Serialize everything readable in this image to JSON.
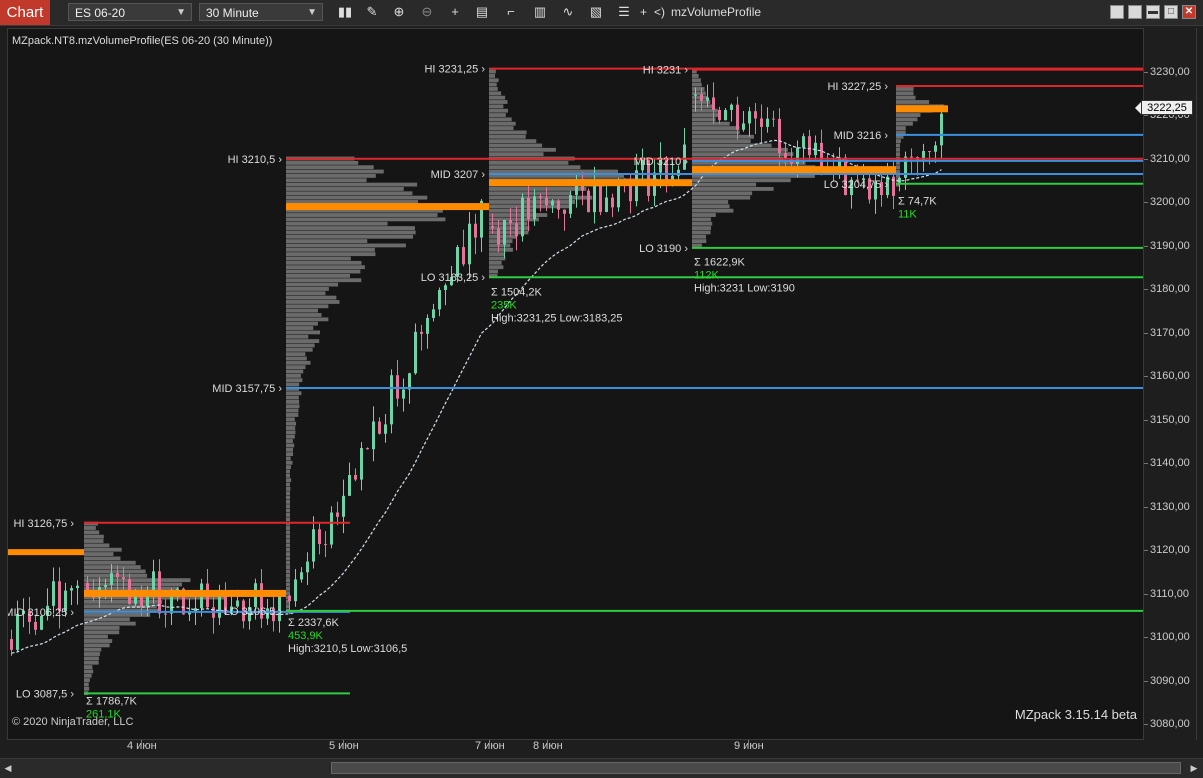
{
  "toolbar": {
    "chart_tab": "Chart",
    "instrument": "ES 06-20",
    "interval": "30 Minute",
    "indicator_name": "mzVolumeProfile",
    "plus_label": "+",
    "prev_label": "<)",
    "icons": [
      "bar-type-icon",
      "draw-pencil-icon",
      "zoom-in-icon",
      "zoom-out-icon",
      "crosshair-icon",
      "data-box-icon",
      "templates-icon",
      "strategies-icon",
      "indicators-icon",
      "properties-icon",
      "menu-icon"
    ]
  },
  "chart": {
    "title": "MZpack.NT8.mzVolumeProfile(ES 06-20 (30 Minute))",
    "copyright": "© 2020 NinjaTrader, LLC",
    "watermark": "MZpack 3.15.14 beta",
    "current_price": "3222,25",
    "colors": {
      "hi_line": "#e0262a",
      "lo_line": "#2ecc40",
      "mid_line": "#3b8fe0",
      "poc": "#ff8c00",
      "profile": "#7a7a7a",
      "va": "#9a9a9a",
      "green_text": "#22dd22",
      "up_candle": "#6fd3a8",
      "down_candle": "#e57399",
      "vwap": "#cfe0ea"
    }
  },
  "chart_data": {
    "type": "candlestick_volume_profile",
    "y_ticks": [
      "3230,00",
      "3220,00",
      "3210,00",
      "3200,00",
      "3190,00",
      "3180,00",
      "3170,00",
      "3160,00",
      "3150,00",
      "3140,00",
      "3130,00",
      "3120,00",
      "3110,00",
      "3100,00",
      "3090,00",
      "3080,00"
    ],
    "y_range": [
      3080,
      3234
    ],
    "x_ticks": [
      "4 июн",
      "5 июн",
      "7 июн",
      "8 июн",
      "9 июн"
    ],
    "profiles": [
      {
        "hi": "HI 3126,75",
        "mid": "MID 3106,25",
        "lo": "LO 3087,5",
        "poc": 3110.5,
        "sum": "Σ 1786,7K",
        "delta": "261,1K",
        "hi_v": 3126.75,
        "mid_v": 3106.25,
        "lo_v": 3087.5
      },
      {
        "hi": "HI 3210,5",
        "mid": "MID 3157,75",
        "lo": "LO 3106,5",
        "poc": 3199.5,
        "sum": "Σ 2337,6K",
        "delta": "453,9K",
        "range": "High:3210,5 Low:3106,5",
        "hi_v": 3210.5,
        "mid_v": 3157.75,
        "lo_v": 3106.5
      },
      {
        "hi": "HI 3231,25",
        "mid": "MID 3207",
        "lo": "LO 3183,25",
        "poc": 3205,
        "sum": "Σ 1504,2K",
        "delta": "235K",
        "range": "High:3231,25 Low:3183,25",
        "hi_v": 3231.25,
        "mid_v": 3207,
        "lo_v": 3183.25
      },
      {
        "hi": "HI 3231",
        "mid": "MID 3210",
        "lo": "LO 3190",
        "poc": 3208,
        "sum": "Σ 1622,9K",
        "delta": "112K",
        "range": "High:3231 Low:3190",
        "hi_v": 3231,
        "mid_v": 3210,
        "lo_v": 3190
      },
      {
        "hi": "HI 3227,25",
        "mid": "MID 3216",
        "lo": "LO 3204,75",
        "poc": 3222,
        "sum": "Σ 74,7K",
        "delta": "11K",
        "hi_v": 3227.25,
        "mid_v": 3216,
        "lo_v": 3204.75
      }
    ]
  }
}
